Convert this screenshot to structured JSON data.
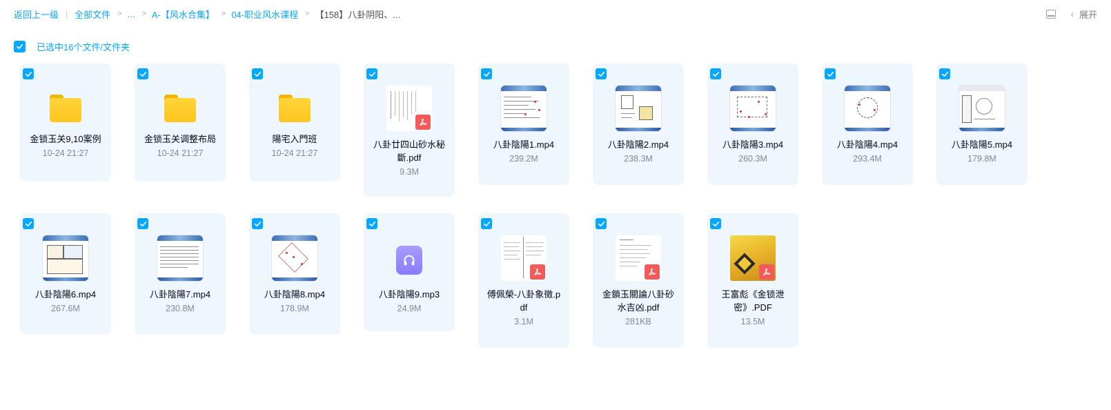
{
  "breadcrumb": {
    "back": "返回上一级",
    "all_files": "全部文件",
    "ellipsis": "...",
    "path1": "A-【风水合集】",
    "path2": "04-职业风水课程",
    "current": "【158】八卦阴阳、..."
  },
  "toolbar": {
    "expand_label": "展开",
    "panel_icon": "panel-icon",
    "chevron_icon": "chevron-left-icon"
  },
  "selection": {
    "label": "已选中16个文件/文件夹",
    "checked": true
  },
  "colors": {
    "accent": "#06a7ff",
    "card_bg": "#eef7fe",
    "pdf_badge": "#f35a5a",
    "folder": "#ffc51e",
    "audio": "#8a7bff"
  },
  "files": [
    {
      "name": "金锁玉关9,10案例",
      "meta": "10-24 21:27",
      "type": "folder"
    },
    {
      "name": "金锁玉关调整布局",
      "meta": "10-24 21:27",
      "type": "folder"
    },
    {
      "name": "陽宅入門班",
      "meta": "10-24 21:27",
      "type": "folder"
    },
    {
      "name": "八卦廿四山砂水秘斷.pdf",
      "meta": "9.3M",
      "type": "pdf"
    },
    {
      "name": "八卦陰陽1.mp4",
      "meta": "239.2M",
      "type": "video"
    },
    {
      "name": "八卦陰陽2.mp4",
      "meta": "238.3M",
      "type": "video"
    },
    {
      "name": "八卦陰陽3.mp4",
      "meta": "260.3M",
      "type": "video"
    },
    {
      "name": "八卦陰陽4.mp4",
      "meta": "293.4M",
      "type": "video"
    },
    {
      "name": "八卦陰陽5.mp4",
      "meta": "179.8M",
      "type": "video"
    },
    {
      "name": "八卦陰陽6.mp4",
      "meta": "267.6M",
      "type": "video"
    },
    {
      "name": "八卦陰陽7.mp4",
      "meta": "230.8M",
      "type": "video"
    },
    {
      "name": "八卦陰陽8.mp4",
      "meta": "178.9M",
      "type": "video"
    },
    {
      "name": "八卦陰陽9.mp3",
      "meta": "24.9M",
      "type": "audio"
    },
    {
      "name": "傅佩榮-八卦象徵.pdf",
      "meta": "3.1M",
      "type": "pdf"
    },
    {
      "name": "金鎖玉關論八卦砂水吉凶.pdf",
      "meta": "281KB",
      "type": "pdf"
    },
    {
      "name": "王富彪《金锁泄密》.PDF",
      "meta": "13.5M",
      "type": "pdf"
    }
  ]
}
